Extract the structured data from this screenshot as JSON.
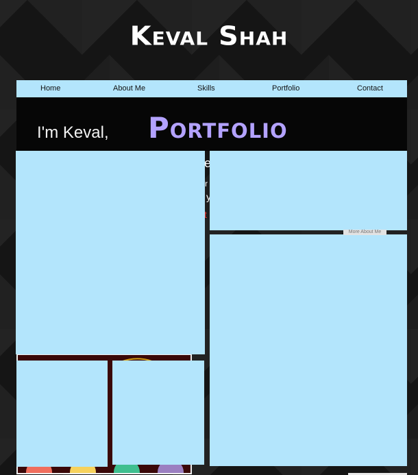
{
  "site": {
    "logo": "Keval Shah"
  },
  "nav": {
    "items": [
      {
        "label": "Home"
      },
      {
        "label": "About Me"
      },
      {
        "label": "Skills"
      },
      {
        "label": "Portfolio"
      },
      {
        "label": "Contact"
      }
    ]
  },
  "hero": {
    "greeting": "I'm Keval,",
    "section_title": "Portfolio",
    "more_button": "More About Me"
  },
  "colors": {
    "nav_background": "#b3e5fc",
    "panel_background": "#b3e5fc",
    "title_color": "#b3a2ff",
    "page_background": "#151515"
  }
}
